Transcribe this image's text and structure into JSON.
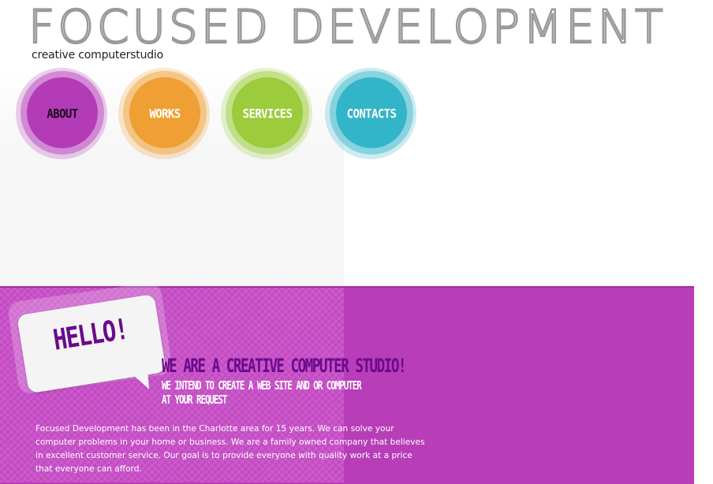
{
  "header": {
    "logo_title": "FOCUSED DEVELOPMENT",
    "logo_subtitle": "creative computerstudio"
  },
  "nav": {
    "items": [
      {
        "label": "ABOUT",
        "color": "#b33bb8",
        "text_color": "#1a0a1a"
      },
      {
        "label": "WORKS",
        "color": "#ef9f33",
        "text_color": "#ffffff"
      },
      {
        "label": "SERVICES",
        "color": "#9ccb3c",
        "text_color": "#ffffff"
      },
      {
        "label": "CONTACTS",
        "color": "#33b5c9",
        "text_color": "#ffffff"
      }
    ]
  },
  "hero": {
    "bubble_text": "HELLO!",
    "headline": "WE ARE A CREATIVE COMPUTER STUDIO!",
    "subhead_lines": [
      "WE INTEND TO CREATE A WEB SITE AND OR COMPUTER",
      "AT YOUR REQUEST"
    ],
    "body_lines": [
      "Focused Development has been in the Charlotte area for 15 years. We can solve your",
      "computer problems in your home or business. We are a family owned company that believes",
      "in excellent customer service. Our goal is to provide everyone with quality work at a price",
      "that everyone can afford."
    ]
  },
  "colors": {
    "band": "#b83db8",
    "headline": "#6a0a8a"
  }
}
